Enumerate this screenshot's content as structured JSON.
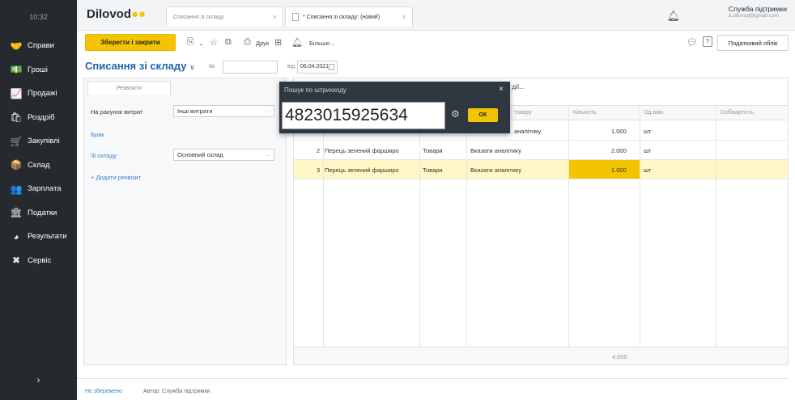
{
  "sidebar": {
    "time": "10:32",
    "items": [
      {
        "label": "Справи",
        "icon": "handshake-icon",
        "glyph": "🤝"
      },
      {
        "label": "Гроші",
        "icon": "money-icon",
        "glyph": "💵"
      },
      {
        "label": "Продажі",
        "icon": "chart-icon",
        "glyph": "📈"
      },
      {
        "label": "Роздріб",
        "icon": "shop-icon",
        "glyph": "🛍"
      },
      {
        "label": "Закупівлі",
        "icon": "cart-icon",
        "glyph": "🛒"
      },
      {
        "label": "Склад",
        "icon": "warehouse-icon",
        "glyph": "📦"
      },
      {
        "label": "Зарплата",
        "icon": "people-icon",
        "glyph": "👥"
      },
      {
        "label": "Податки",
        "icon": "tax-icon",
        "glyph": "🏛"
      },
      {
        "label": "Результати",
        "icon": "pie-icon",
        "glyph": "◕"
      },
      {
        "label": "Сервіс",
        "icon": "tools-icon",
        "glyph": "✖"
      }
    ],
    "chevron": "›"
  },
  "topbar": {
    "logo": "Dilovod",
    "tabs": [
      {
        "label": "Списання зі складу",
        "close": "×"
      },
      {
        "label": "* Списання зі складу: (новий)",
        "close": "×"
      }
    ],
    "user_name": "Служба підтримки",
    "user_email": "a.dilovod@gmail.com"
  },
  "toolbar": {
    "save_label": "Зберегти і закрити",
    "print_label": "Друк",
    "more_label": "Більше...",
    "tax_label": "Податковий облік",
    "help": "?"
  },
  "header": {
    "title": "Списання зі складу",
    "number_label": "№",
    "number_value": "",
    "from_label": "від",
    "date_value": "06.04.2021"
  },
  "left_panel": {
    "tab": "Реквізити",
    "rows": [
      {
        "label": "На рахунок витрат",
        "value": "Інші витрати"
      },
      {
        "label": "Брак",
        "value": ""
      },
      {
        "label": "Зі складу",
        "value": "Основний склад"
      }
    ],
    "add_link": "+ Додати реквізит",
    "dots": "..."
  },
  "table": {
    "toolbar_text": "дії...",
    "columns": [
      "товару",
      "Кількість",
      "Од.вим.",
      "Собівартість"
    ],
    "rows": [
      {
        "num": "",
        "name": "",
        "type": "",
        "link": "аналітику",
        "qty": "1.000",
        "unit": "шт"
      },
      {
        "num": "2",
        "name": "Перець зелений фарширо",
        "type": "Товари",
        "link": "Вказати аналітику",
        "qty": "2.000",
        "unit": "шт"
      },
      {
        "num": "3",
        "name": "Перець зелений фарширо",
        "type": "Товари",
        "link": "Вказати аналітику",
        "qty": "1.000",
        "unit": "шт"
      }
    ],
    "total_qty": "4.000"
  },
  "barcode_dialog": {
    "title": "Пошук по штрихкоду",
    "value": "4823015925634",
    "ok_label": "ОК",
    "close": "×"
  },
  "footer": {
    "status": "Не збережено",
    "author": "Автор: Служба підтримки"
  },
  "colors": {
    "accent": "#f4c400",
    "sidebar": "#262a2e",
    "link": "#3a83c9",
    "title": "#2163a8"
  }
}
